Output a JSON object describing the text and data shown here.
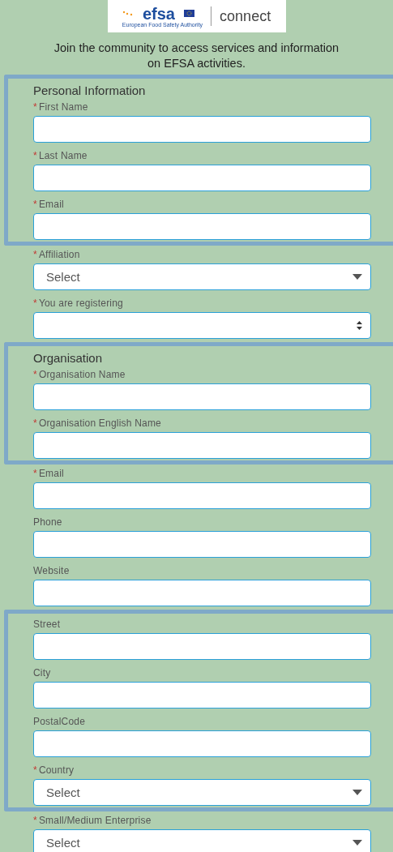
{
  "header": {
    "logo_text": "efsa",
    "logo_caption": "European Food Safety Authority",
    "product": "connect"
  },
  "required_mark": "*",
  "intro": [
    "Join the community to access services and information",
    "on EFSA activities."
  ],
  "groups": [
    {
      "highlighted": true,
      "heading": "Personal Information",
      "fields": [
        {
          "kind": "text",
          "label": "First Name",
          "required": true
        },
        {
          "kind": "text",
          "label": "Last Name",
          "required": true
        },
        {
          "kind": "text",
          "label": "Email",
          "required": true
        }
      ]
    },
    {
      "highlighted": false,
      "fields": [
        {
          "kind": "select",
          "label": "Affiliation",
          "required": true,
          "value": "Select"
        },
        {
          "kind": "spinner",
          "label": "You are registering",
          "required": true
        }
      ]
    },
    {
      "highlighted": true,
      "heading": "Organisation",
      "fields": [
        {
          "kind": "text",
          "label": "Organisation Name",
          "required": true
        },
        {
          "kind": "text",
          "label": "Organisation English Name",
          "required": true
        }
      ]
    },
    {
      "highlighted": false,
      "fields": [
        {
          "kind": "text",
          "label": "Email",
          "required": true
        },
        {
          "kind": "text",
          "label": "Phone",
          "required": false
        },
        {
          "kind": "text",
          "label": "Website",
          "required": false
        }
      ]
    },
    {
      "highlighted": true,
      "fields": [
        {
          "kind": "text",
          "label": "Street",
          "required": false
        },
        {
          "kind": "text",
          "label": "City",
          "required": false
        },
        {
          "kind": "text",
          "label": "PostalCode",
          "required": false
        },
        {
          "kind": "select",
          "label": "Country",
          "required": true,
          "value": "Select"
        }
      ]
    },
    {
      "highlighted": false,
      "fields": [
        {
          "kind": "select",
          "label": "Small/Medium Enterprise",
          "required": true,
          "value": "Select"
        }
      ]
    }
  ]
}
